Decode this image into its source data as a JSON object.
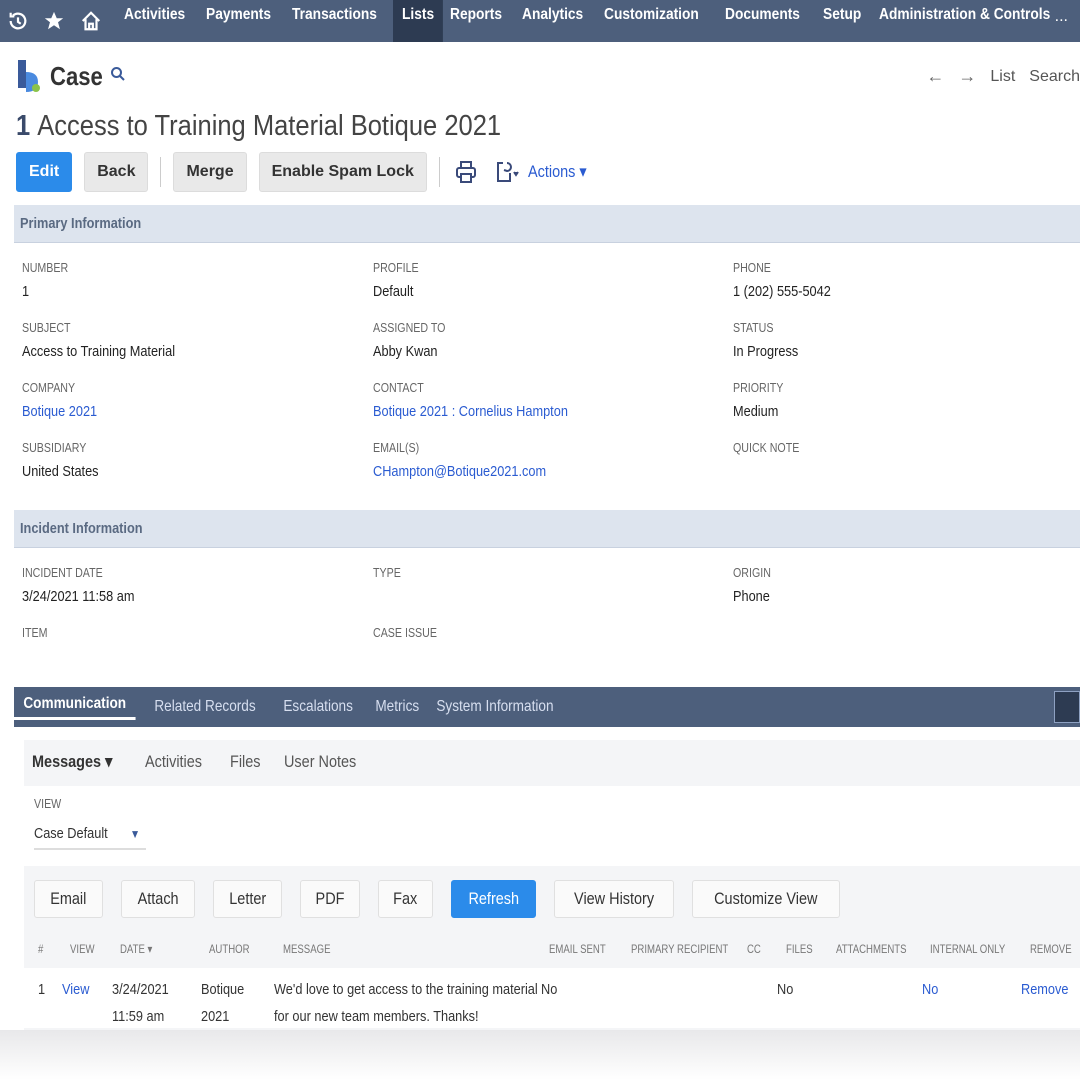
{
  "nav": {
    "icons": [
      "history-icon",
      "star-icon",
      "home-icon"
    ],
    "items": [
      "Activities",
      "Payments",
      "Transactions",
      "Lists",
      "Reports",
      "Analytics",
      "Customization",
      "Documents",
      "Setup",
      "Administration & Controls"
    ],
    "active": "Lists",
    "more": "..."
  },
  "record": {
    "type": "Case",
    "number": "1",
    "title": "Access to Training Material Botique 2021"
  },
  "top_right": {
    "back_arrow": "←",
    "forward_arrow": "→",
    "list": "List",
    "search": "Search"
  },
  "toolbar": {
    "edit": "Edit",
    "back": "Back",
    "merge": "Merge",
    "spam_lock": "Enable Spam Lock",
    "actions": "Actions ▾"
  },
  "primary": {
    "header": "Primary Information",
    "number_label": "NUMBER",
    "number": "1",
    "profile_label": "PROFILE",
    "profile": "Default",
    "phone_label": "PHONE",
    "phone": "1 (202) 555-5042",
    "subject_label": "SUBJECT",
    "subject": "Access to Training Material",
    "assigned_label": "ASSIGNED TO",
    "assigned": "Abby Kwan",
    "status_label": "STATUS",
    "status": "In Progress",
    "company_label": "COMPANY",
    "company": "Botique 2021",
    "contact_label": "CONTACT",
    "contact": "Botique 2021 : Cornelius Hampton",
    "priority_label": "PRIORITY",
    "priority": "Medium",
    "subsidiary_label": "SUBSIDIARY",
    "subsidiary": "United States",
    "email_label": "EMAIL(S)",
    "email": "CHampton@Botique2021.com",
    "quicknote_label": "QUICK NOTE"
  },
  "incident": {
    "header": "Incident Information",
    "date_label": "INCIDENT DATE",
    "date": "3/24/2021 11:58 am",
    "type_label": "TYPE",
    "origin_label": "ORIGIN",
    "origin": "Phone",
    "item_label": "ITEM",
    "case_issue_label": "CASE ISSUE"
  },
  "subtabs": [
    "Communication",
    "Related Records",
    "Escalations",
    "Metrics",
    "System Information"
  ],
  "messages": {
    "tabs": [
      "Messages ▾",
      "Activities",
      "Files",
      "User Notes"
    ],
    "view_label": "VIEW",
    "view_value": "Case Default",
    "buttons": [
      "Email",
      "Attach",
      "Letter",
      "PDF",
      "Fax",
      "Refresh",
      "View History",
      "Customize View"
    ],
    "columns": [
      "#",
      "VIEW",
      "DATE ▾",
      "AUTHOR",
      "MESSAGE",
      "EMAIL SENT",
      "PRIMARY RECIPIENT",
      "CC",
      "FILES",
      "ATTACHMENTS",
      "INTERNAL ONLY",
      "REMOVE"
    ],
    "row": {
      "num": "1",
      "view": "View",
      "date1": "3/24/2021",
      "date2": "11:59 am",
      "author1": "Botique",
      "author2": "2021",
      "msg1": "We'd love to get access to the training material",
      "msg2": "for our new team members. Thanks!",
      "email_sent": "No",
      "files": "No",
      "internal_only": "No",
      "remove": "Remove"
    }
  },
  "colors": {
    "nav_bg": "#4d5f7c",
    "accent": "#2b8bea",
    "link": "#2a5bd1",
    "section_bg": "#dde4ee"
  }
}
